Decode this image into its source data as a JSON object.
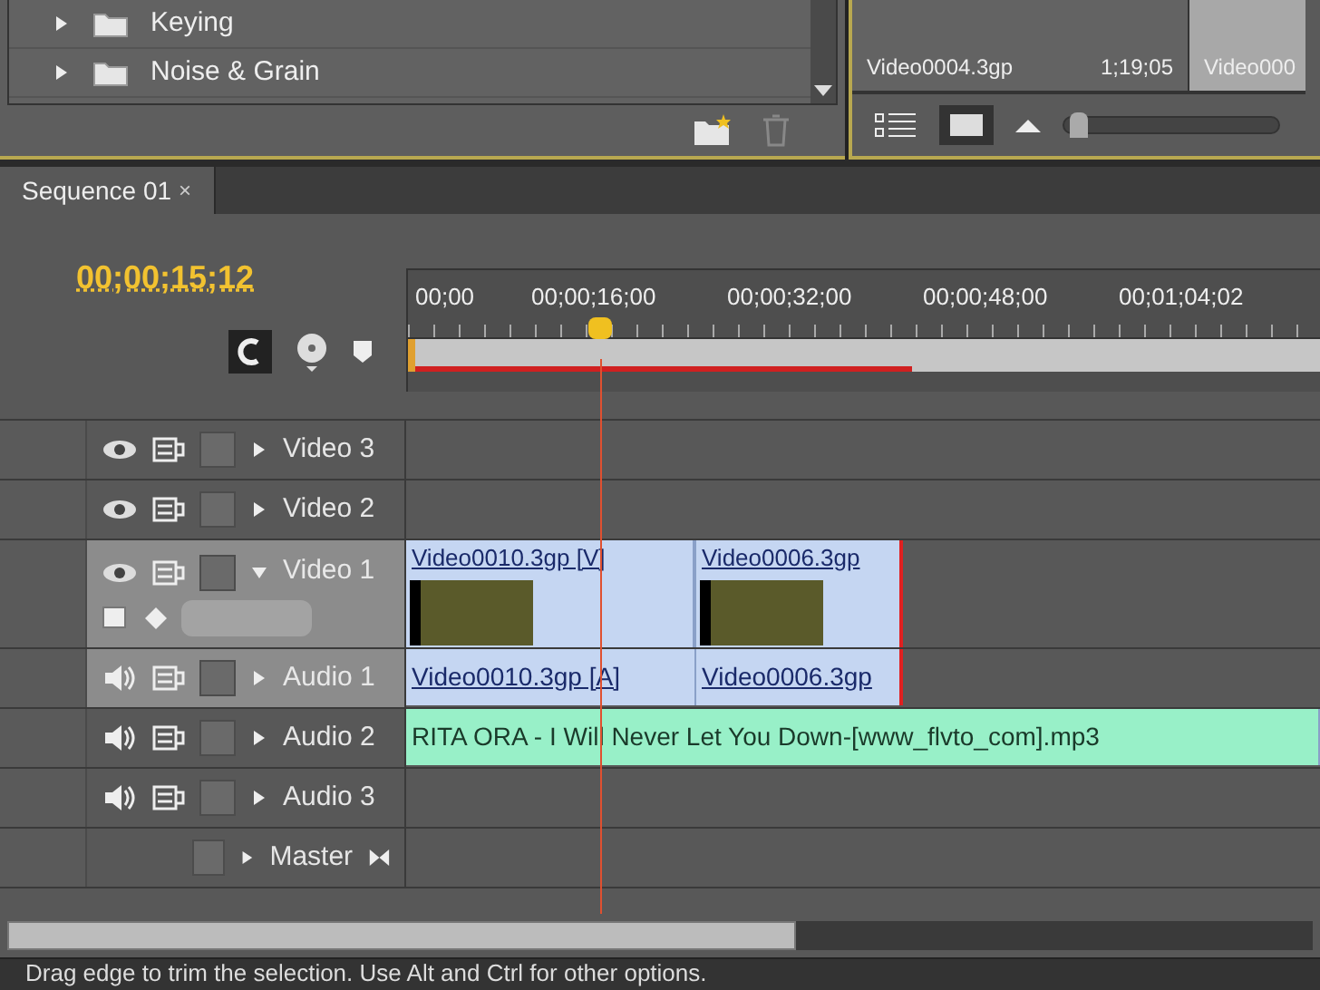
{
  "effects_panel": {
    "items": [
      {
        "label": "Keying"
      },
      {
        "label": "Noise & Grain"
      }
    ]
  },
  "project_panel": {
    "thumbnails": [
      {
        "name": "Video0004.3gp",
        "duration": "1;19;05",
        "selected": false
      },
      {
        "name": "Video000",
        "selected": true
      }
    ],
    "zoom": {
      "level": 0.03
    }
  },
  "sequence_tab": {
    "label": "Sequence 01",
    "close": "×"
  },
  "timecode": "00;00;15;12",
  "ruler": {
    "labels": [
      "00;00",
      "00;00;16;00",
      "00;00;32;00",
      "00;00;48;00",
      "00;01;04;02"
    ],
    "playhead": {
      "level": 0.21
    },
    "work_area": {
      "level": 0.55
    }
  },
  "tracks": [
    {
      "kind": "video",
      "name": "Video 3",
      "selected": false,
      "expanded": false
    },
    {
      "kind": "video",
      "name": "Video 2",
      "selected": false,
      "expanded": false
    },
    {
      "kind": "video",
      "name": "Video 1",
      "selected": true,
      "expanded": true,
      "clips": [
        {
          "label": "Video0010.3gp [V]"
        },
        {
          "label": "Video0006.3gp"
        }
      ]
    },
    {
      "kind": "audio",
      "name": "Audio 1",
      "selected": true,
      "expanded": false,
      "clips": [
        {
          "label": "Video0010.3gp [A]"
        },
        {
          "label": "Video0006.3gp"
        }
      ]
    },
    {
      "kind": "audio",
      "name": "Audio 2",
      "selected": false,
      "expanded": false,
      "clips": [
        {
          "label": "RITA ORA - I Will Never Let You Down-[www_flvto_com].mp3"
        }
      ]
    },
    {
      "kind": "audio",
      "name": "Audio 3",
      "selected": false,
      "expanded": false
    },
    {
      "kind": "master",
      "name": "Master",
      "selected": false,
      "expanded": false
    }
  ],
  "status_bar": {
    "text": "Drag edge to trim the selection. Use Alt and Ctrl for other options."
  }
}
